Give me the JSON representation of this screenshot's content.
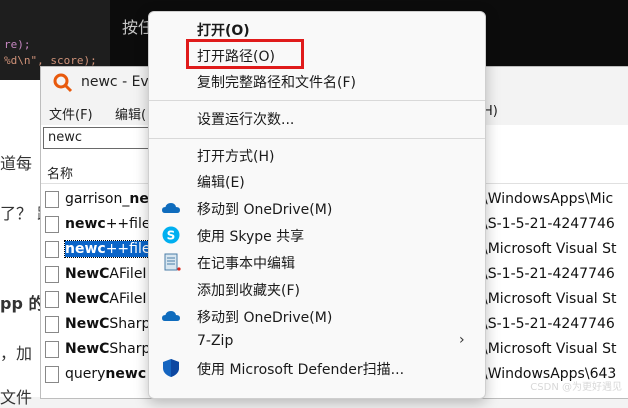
{
  "background": {
    "code_lines": [
      "re);",
      "%d\\n\", score);"
    ],
    "terminal_text": "按任",
    "article_lines": [
      "道每",
      "了？ 跳",
      "pp 的",
      "，加",
      "文件"
    ]
  },
  "everything": {
    "title": "newc - Everything",
    "title_visible": "newc - Ever",
    "menus": [
      "文件(F)",
      "编辑(",
      "H)"
    ],
    "search_value": "newc",
    "column_name": "名称",
    "rows": [
      {
        "name_pre": "garrison_",
        "name_bold": "ne",
        "name_post": "",
        "path": "\\WindowsApps\\Mic",
        "selected": false
      },
      {
        "name_pre": "",
        "name_bold": "newc",
        "name_post": "++file",
        "path": "\\S-1-5-21-4247746",
        "selected": false
      },
      {
        "name_pre": "",
        "name_bold": "newc",
        "name_post": "++file",
        "path": "\\Microsoft Visual St",
        "selected": true
      },
      {
        "name_pre": "",
        "name_bold": "NewC",
        "name_post": "AFileI",
        "path": "\\S-1-5-21-4247746",
        "selected": false
      },
      {
        "name_pre": "",
        "name_bold": "NewC",
        "name_post": "AFileI",
        "path": "\\Microsoft Visual St",
        "selected": false
      },
      {
        "name_pre": "",
        "name_bold": "NewC",
        "name_post": "Sharp",
        "path": "\\S-1-5-21-4247746",
        "selected": false
      },
      {
        "name_pre": "",
        "name_bold": "NewC",
        "name_post": "Sharp",
        "path": "\\Microsoft Visual St",
        "selected": false
      },
      {
        "name_pre": "query",
        "name_bold": "newc",
        "name_post": "",
        "path": "\\WindowsApps\\643",
        "selected": false
      }
    ]
  },
  "context_menu": {
    "items": [
      {
        "label": "打开(O)",
        "bold": true,
        "icon": ""
      },
      {
        "label": "打开路径(O)",
        "bold": false,
        "icon": "",
        "highlighted": true
      },
      {
        "label": "复制完整路径和文件名(F)",
        "bold": false,
        "icon": ""
      },
      {
        "label": "设置运行次数...",
        "bold": false,
        "icon": ""
      },
      {
        "label": "打开方式(H)",
        "bold": false,
        "icon": ""
      },
      {
        "label": "编辑(E)",
        "bold": false,
        "icon": ""
      },
      {
        "label": "移动到 OneDrive(M)",
        "bold": false,
        "icon": "onedrive-icon"
      },
      {
        "label": "使用 Skype 共享",
        "bold": false,
        "icon": "skype-icon"
      },
      {
        "label": "在记事本中编辑",
        "bold": false,
        "icon": "notepad-icon"
      },
      {
        "label": "添加到收藏夹(F)",
        "bold": false,
        "icon": ""
      },
      {
        "label": "移动到 OneDrive(M)",
        "bold": false,
        "icon": "onedrive-icon"
      },
      {
        "label": "7-Zip",
        "bold": false,
        "icon": "",
        "submenu": true
      },
      {
        "label": "使用 Microsoft Defender扫描...",
        "bold": false,
        "icon": "defender-icon"
      }
    ],
    "highlight_color": "#e01b1b"
  },
  "watermark": "CSDN @为更好遇见",
  "colors": {
    "selection": "#0a64c8",
    "onedrive": "#0f6cbd",
    "skype": "#00aff0",
    "defender": "#1565c0"
  }
}
